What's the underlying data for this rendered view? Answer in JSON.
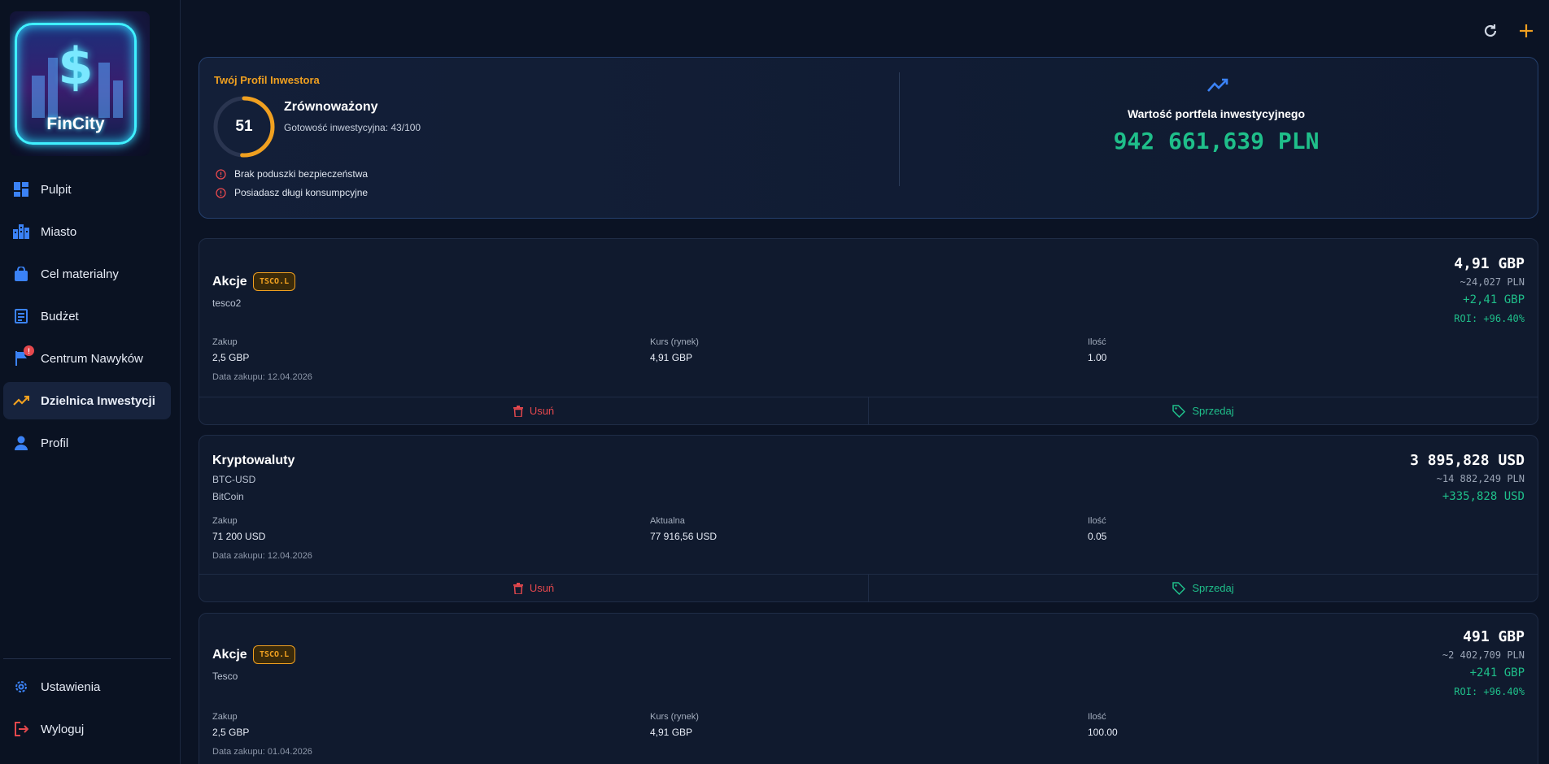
{
  "app": {
    "name": "FinCity"
  },
  "sidebar": {
    "items": [
      {
        "label": "Pulpit",
        "icon": "dashboard-icon"
      },
      {
        "label": "Miasto",
        "icon": "city-icon"
      },
      {
        "label": "Cel materialny",
        "icon": "shopping-bag-icon"
      },
      {
        "label": "Budżet",
        "icon": "receipt-icon"
      },
      {
        "label": "Centrum Nawyków",
        "icon": "flag-icon",
        "badge": "!"
      },
      {
        "label": "Dzielnica Inwestycji",
        "icon": "trending-up-icon",
        "active": true
      },
      {
        "label": "Profil",
        "icon": "person-icon"
      }
    ],
    "bottom": [
      {
        "label": "Ustawienia",
        "icon": "gear-icon"
      },
      {
        "label": "Wyloguj",
        "icon": "logout-icon"
      }
    ]
  },
  "colors": {
    "accent": "#f0a020",
    "positive": "#1fbf8a",
    "negative": "#e5484d",
    "nav_icon": "#3b82f6",
    "background": "#0b1324"
  },
  "profile": {
    "title": "Twój Profil Inwestora",
    "score": "51",
    "score_progress": 0.51,
    "level": "Zrównoważony",
    "readiness": "Gotowość inwestycyjna: 43/100",
    "warnings": [
      "Brak poduszki bezpieczeństwa",
      "Posiadasz długi konsumpcyjne"
    ]
  },
  "portfolio": {
    "label": "Wartość portfela inwestycyjnego",
    "value": "942 661,639 PLN"
  },
  "investments": [
    {
      "type": "Akcje",
      "ticker": "TSCO.L",
      "name": "tesco2",
      "amount": "4,91 GBP",
      "amount_pln": "~24,027 PLN",
      "gain": "+2,41 GBP",
      "roi": "ROI: +96.40%",
      "cols": [
        {
          "label": "Zakup",
          "value": "2,5 GBP"
        },
        {
          "label": "Kurs (rynek)",
          "value": "4,91 GBP"
        },
        {
          "label": "Ilość",
          "value": "1.00"
        }
      ],
      "date": "Data zakupu: 12.04.2026",
      "delete_label": "Usuń",
      "sell_label": "Sprzedaj"
    },
    {
      "type": "Kryptowaluty",
      "ticker": "",
      "symbol": "BTC-USD",
      "name": "BitCoin",
      "amount": "3 895,828 USD",
      "amount_pln": "~14 882,249 PLN",
      "gain": "+335,828 USD",
      "roi": "",
      "cols": [
        {
          "label": "Zakup",
          "value": "71 200 USD"
        },
        {
          "label": "Aktualna",
          "value": "77 916,56 USD"
        },
        {
          "label": "Ilość",
          "value": "0.05"
        }
      ],
      "date": "Data zakupu: 12.04.2026",
      "delete_label": "Usuń",
      "sell_label": "Sprzedaj"
    },
    {
      "type": "Akcje",
      "ticker": "TSCO.L",
      "name": "Tesco",
      "amount": "491 GBP",
      "amount_pln": "~2 402,709 PLN",
      "gain": "+241 GBP",
      "roi": "ROI: +96.40%",
      "cols": [
        {
          "label": "Zakup",
          "value": "2,5 GBP"
        },
        {
          "label": "Kurs (rynek)",
          "value": "4,91 GBP"
        },
        {
          "label": "Ilość",
          "value": "100.00"
        }
      ],
      "date": "Data zakupu: 01.04.2026"
    }
  ]
}
